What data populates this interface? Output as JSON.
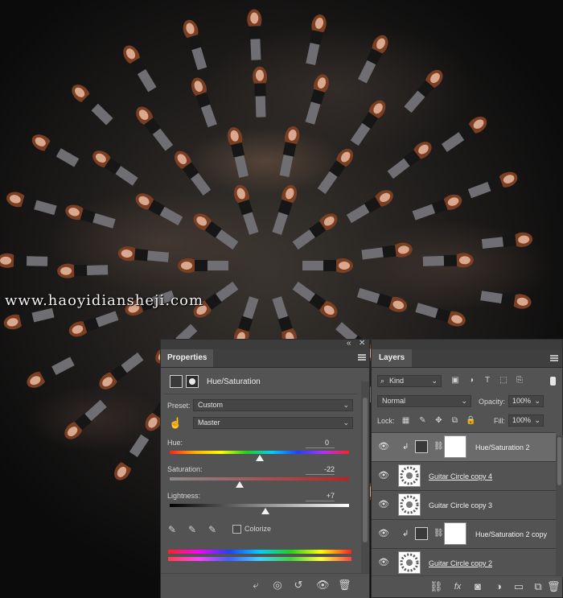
{
  "watermark": "www.haoyidiansheji.com",
  "properties": {
    "tab": "Properties",
    "adjustment_title": "Hue/Saturation",
    "preset_label": "Preset:",
    "preset_value": "Custom",
    "channel_value": "Master",
    "hue_label": "Hue:",
    "hue_value": "0",
    "saturation_label": "Saturation:",
    "saturation_value": "-22",
    "lightness_label": "Lightness:",
    "lightness_value": "+7",
    "colorize_label": "Colorize",
    "sliders": {
      "hue": 0,
      "saturation": -22,
      "lightness": 7
    }
  },
  "layers": {
    "tab": "Layers",
    "filter_kind": "Kind",
    "blend_mode": "Normal",
    "opacity_label": "Opacity:",
    "opacity_value": "100%",
    "lock_label": "Lock:",
    "fill_label": "Fill:",
    "fill_value": "100%",
    "items": [
      {
        "name": "Hue/Saturation 2",
        "type": "adjustment",
        "selected": true
      },
      {
        "name": "Guitar Circle copy 4",
        "type": "image",
        "underlined": true
      },
      {
        "name": "Guitar Circle copy 3",
        "type": "image"
      },
      {
        "name": "Hue/Saturation 2 copy",
        "type": "adjustment"
      },
      {
        "name": "Guitar Circle copy 2",
        "type": "image",
        "underlined": true
      }
    ]
  },
  "colors": {
    "panel_bg": "#535353",
    "selected_row": "#6b6b6b",
    "slider_thumb": "#f2f2f2"
  },
  "icons": [
    "eye-icon",
    "link-icon",
    "clip-arrow-icon",
    "fx-icon",
    "mask-icon",
    "adjustment-icon",
    "folder-icon",
    "new-layer-icon",
    "trash-icon",
    "eyedropper-icon",
    "hand-target-icon",
    "reset-icon",
    "visibility-icon",
    "search-icon",
    "menu-icon",
    "lock-icon"
  ]
}
